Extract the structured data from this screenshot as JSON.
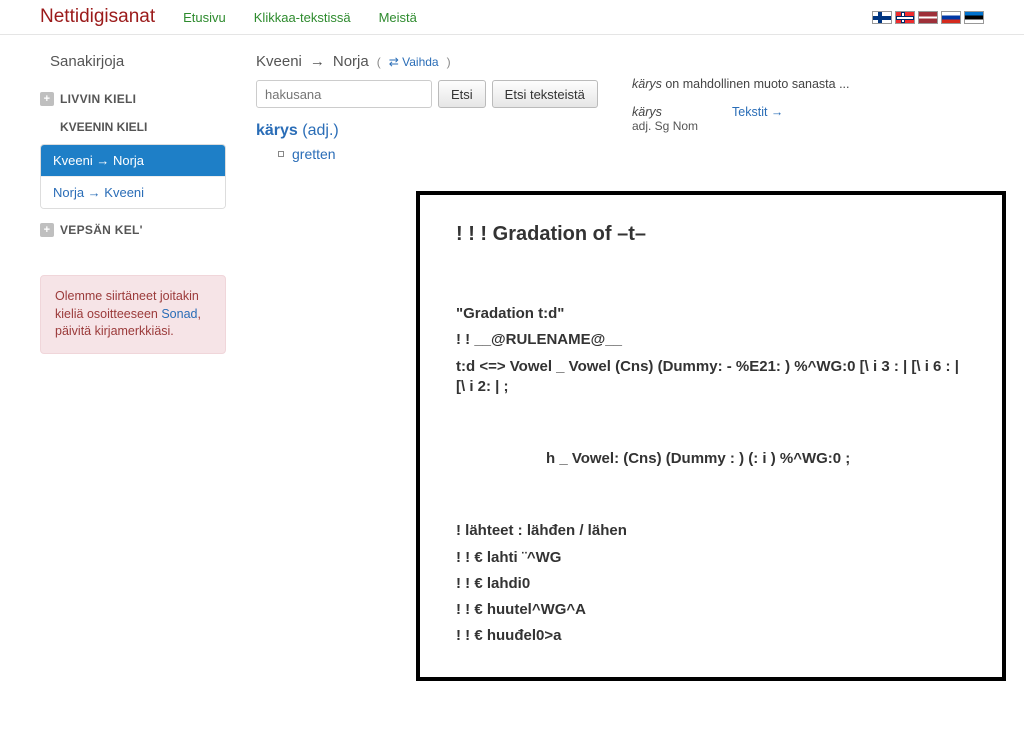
{
  "header": {
    "brand": "Nettidigisanat",
    "nav": [
      "Etusivu",
      "Klikkaa-tekstissä",
      "Meistä"
    ]
  },
  "sidebar": {
    "title": "Sanakirjoja",
    "groups": {
      "livvin": "LIVVIN KIELI",
      "kveenin": "KVEENIN KIELI",
      "vepsan": "VEPSÄN KEL'"
    },
    "directions": {
      "kv_no": "Kveeni → Norja",
      "no_kv": "Norja → Kveeni"
    },
    "alert_pre": "Olemme siirtäneet joitakin kieliä osoitteeseen ",
    "alert_link": "Sonad",
    "alert_post": ", päivitä kirjamerkkiäsi."
  },
  "main": {
    "crumb_from": "Kveeni",
    "crumb_to": "Norja",
    "swap": "⇄ Vaihda",
    "search_placeholder": "hakusana",
    "btn_search": "Etsi",
    "btn_texts": "Etsi teksteistä",
    "entry": {
      "headword": "kärys",
      "pos": "(adj.)",
      "sense": "gretten"
    },
    "right": {
      "hint_word": "kärys",
      "hint_rest": " on mahdollinen muoto sanasta ...",
      "lemma": "kärys",
      "morph": "adj. Sg Nom",
      "texts_link": "Tekstit →"
    }
  },
  "codebox": {
    "title": "! !     ! Gradation of –t–",
    "l1": "\"Gradation t:d\"",
    "l2": "! !   __@RULENAME@__",
    "l3": "    t:d  <=> Vowel  _   Vowel  (Cns)   (Dummy:  - %E21: )   %^WG:0  [\\ i 3 : | [\\ i 6 : | [\\ i 2: | ;",
    "l4": "h  _ Vowel: (Cns)  (Dummy : )   (: i )  %^WG:0  ;",
    "l5": "! lähteet  : lähđen / lähen",
    "l6": "! ! €  lahti ¨^WG",
    "l7": "! ! €  lahdi0",
    "l8": "! ! € huutel^WG^A",
    "l9": "! ! € huuđel0>a"
  }
}
